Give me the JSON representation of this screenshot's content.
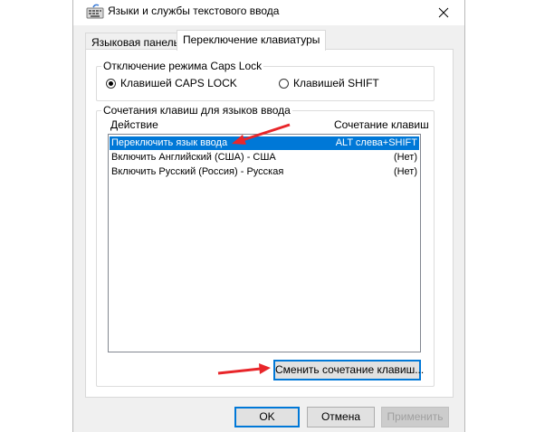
{
  "window": {
    "title": "Языки и службы текстового ввода"
  },
  "tabs": [
    {
      "label": "Языковая панель",
      "active": false
    },
    {
      "label": "Переключение клавиатуры",
      "active": true
    }
  ],
  "caps_lock": {
    "group_label": "Отключение режима Caps Lock",
    "options": [
      {
        "label": "Клавишей CAPS LOCK",
        "selected": true
      },
      {
        "label": "Клавишей SHIFT",
        "selected": false
      }
    ]
  },
  "hotkeys": {
    "group_label": "Сочетания клавиш для языков ввода",
    "column_action": "Действие",
    "column_keys": "Сочетание клавиш",
    "rows": [
      {
        "action": "Переключить язык ввода",
        "keys": "ALT слева+SHIFT",
        "selected": true
      },
      {
        "action": "Включить Английский (США) - США",
        "keys": "(Нет)",
        "selected": false
      },
      {
        "action": "Включить Русский (Россия) - Русская",
        "keys": "(Нет)",
        "selected": false
      }
    ],
    "change_button": "Сменить сочетание клавиш..."
  },
  "footer": {
    "ok": "OK",
    "cancel": "Отмена",
    "apply": "Применить"
  },
  "colors": {
    "selection": "#0078d7",
    "annotation_arrow": "#e8262a"
  }
}
